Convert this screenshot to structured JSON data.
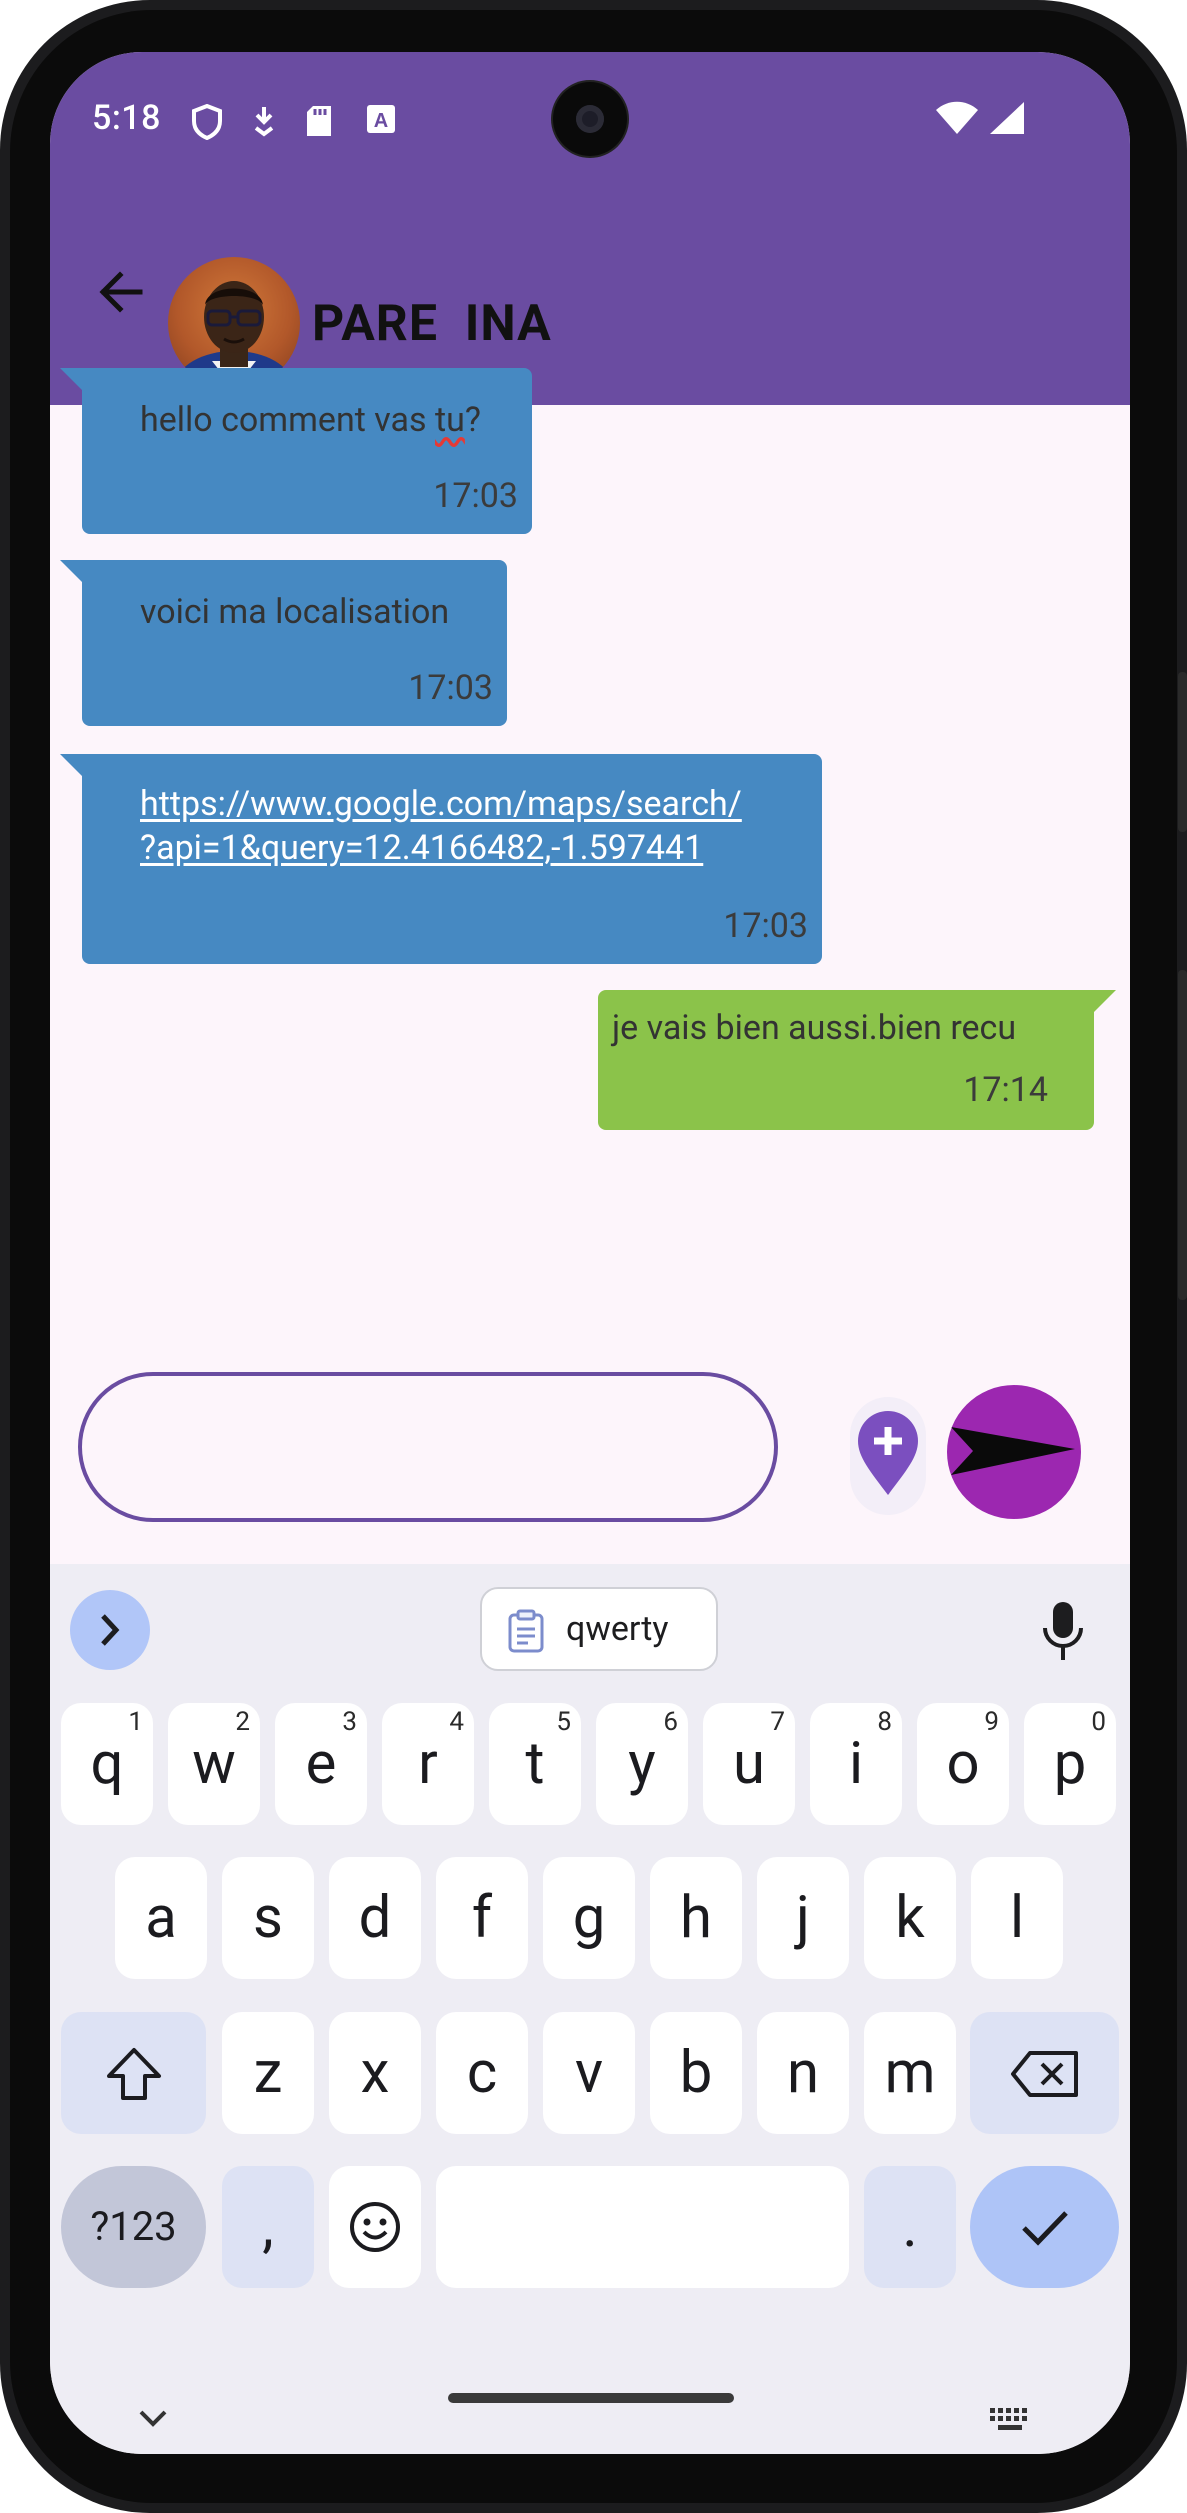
{
  "status_bar": {
    "time": "5:18",
    "icons": [
      "shield-icon",
      "download-icon",
      "sd-card-icon",
      "text-a-icon",
      "wifi-icon",
      "cell-signal-icon"
    ]
  },
  "app_bar": {
    "back_icon": "arrow-back-icon",
    "contact_name": "PARE  INA"
  },
  "messages": [
    {
      "direction": "incoming",
      "text_before": "hello comment vas ",
      "text_flagged": "tu",
      "text_after": "?",
      "time": "17:03"
    },
    {
      "direction": "incoming",
      "text": "voici ma localisation",
      "time": "17:03"
    },
    {
      "direction": "incoming",
      "link_line1": "https://www.google.com/maps/search/",
      "link_line2": "?api=1&query=12.4166482,-1.597441",
      "time": "17:03"
    },
    {
      "direction": "outgoing",
      "text": "je vais bien aussi.bien recu",
      "time": "17:14"
    }
  ],
  "composer": {
    "input_value": "",
    "location_icon": "location-pin-add-icon",
    "send_icon": "send-icon"
  },
  "keyboard": {
    "clipboard_chip": "qwerty",
    "row1": [
      {
        "k": "q",
        "h": "1"
      },
      {
        "k": "w",
        "h": "2"
      },
      {
        "k": "e",
        "h": "3"
      },
      {
        "k": "r",
        "h": "4"
      },
      {
        "k": "t",
        "h": "5"
      },
      {
        "k": "y",
        "h": "6"
      },
      {
        "k": "u",
        "h": "7"
      },
      {
        "k": "i",
        "h": "8"
      },
      {
        "k": "o",
        "h": "9"
      },
      {
        "k": "p",
        "h": "0"
      }
    ],
    "row2": [
      "a",
      "s",
      "d",
      "f",
      "g",
      "h",
      "j",
      "k",
      "l"
    ],
    "row3": [
      "z",
      "x",
      "c",
      "v",
      "b",
      "n",
      "m"
    ],
    "symbols_key": "?123",
    "comma_key": ",",
    "period_key": ".",
    "colors": {
      "keyboard_bg": "#eeedf4",
      "action": "#aec4f7",
      "special": "#dde2f4"
    }
  },
  "colors": {
    "app_bar": "#6a4ca1",
    "incoming_bubble": "#4689c2",
    "outgoing_bubble": "#8bc34a",
    "send_button": "#9c27b0",
    "chat_bg": "#fdf5fb"
  }
}
